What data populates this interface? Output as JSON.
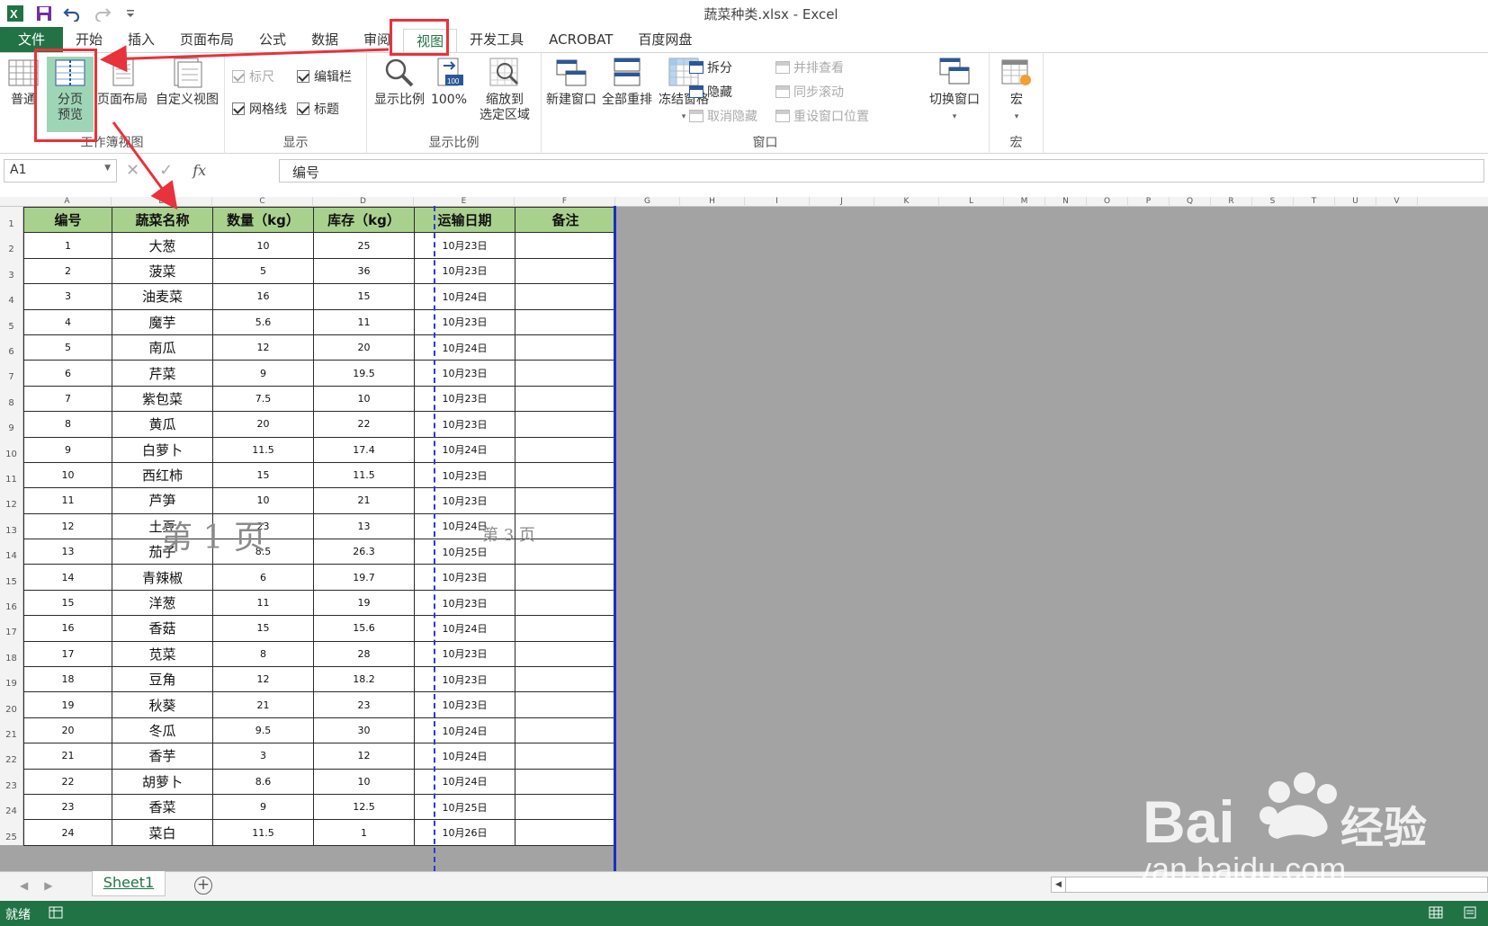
{
  "window": {
    "title": "蔬菜种类.xlsx - Excel"
  },
  "qat": {
    "excel_icon": "excel-logo-icon",
    "save": "save-icon",
    "undo": "undo-icon",
    "redo": "redo-icon",
    "customize": "customize-qat-icon"
  },
  "tabs": [
    "文件",
    "开始",
    "插入",
    "页面布局",
    "公式",
    "数据",
    "审阅",
    "视图",
    "开发工具",
    "ACROBAT",
    "百度网盘"
  ],
  "active_tab": "视图",
  "ribbon": {
    "workbook_views": {
      "label": "工作簿视图",
      "normal": "普通",
      "page_break_1": "分页",
      "page_break_2": "预览",
      "page_layout": "页面布局",
      "custom_views": "自定义视图"
    },
    "show": {
      "label": "显示",
      "ruler": "标尺",
      "formula_bar": "编辑栏",
      "gridlines": "网格线",
      "headings": "标题"
    },
    "zoom": {
      "label": "显示比例",
      "zoom": "显示比例",
      "zoom100": "100%",
      "zoom_sel_1": "缩放到",
      "zoom_sel_2": "选定区域"
    },
    "window": {
      "label": "窗口",
      "new_window": "新建窗口",
      "arrange_all": "全部重排",
      "freeze_panes": "冻结窗格",
      "split": "拆分",
      "hide": "隐藏",
      "unhide": "取消隐藏",
      "side_by_side": "并排查看",
      "sync_scroll": "同步滚动",
      "reset_pos": "重设窗口位置",
      "switch_windows": "切换窗口"
    },
    "macros": {
      "label": "宏",
      "macros": "宏"
    }
  },
  "formula_bar": {
    "name_box": "A1",
    "fx": "fx",
    "content": "编号"
  },
  "columns": [
    "A",
    "B",
    "C",
    "D",
    "E",
    "F",
    "G",
    "H",
    "I",
    "J",
    "K",
    "L",
    "M",
    "N",
    "O",
    "P",
    "Q",
    "R",
    "S",
    "T",
    "U",
    "V"
  ],
  "table": {
    "headers": [
      "编号",
      "蔬菜名称",
      "数量（kg）",
      "库存（kg）",
      "运输日期",
      "备注"
    ],
    "rows": [
      [
        "1",
        "大葱",
        "10",
        "25",
        "10月23日",
        ""
      ],
      [
        "2",
        "菠菜",
        "5",
        "36",
        "10月23日",
        ""
      ],
      [
        "3",
        "油麦菜",
        "16",
        "15",
        "10月24日",
        ""
      ],
      [
        "4",
        "魔芋",
        "5.6",
        "11",
        "10月23日",
        ""
      ],
      [
        "5",
        "南瓜",
        "12",
        "20",
        "10月24日",
        ""
      ],
      [
        "6",
        "芹菜",
        "9",
        "19.5",
        "10月23日",
        ""
      ],
      [
        "7",
        "紫包菜",
        "7.5",
        "10",
        "10月23日",
        ""
      ],
      [
        "8",
        "黄瓜",
        "20",
        "22",
        "10月23日",
        ""
      ],
      [
        "9",
        "白萝卜",
        "11.5",
        "17.4",
        "10月24日",
        ""
      ],
      [
        "10",
        "西红柿",
        "15",
        "11.5",
        "10月23日",
        ""
      ],
      [
        "11",
        "芦笋",
        "10",
        "21",
        "10月23日",
        ""
      ],
      [
        "12",
        "土豆",
        "23",
        "13",
        "10月24日",
        ""
      ],
      [
        "13",
        "茄子",
        "8.5",
        "26.3",
        "10月25日",
        ""
      ],
      [
        "14",
        "青辣椒",
        "6",
        "19.7",
        "10月23日",
        ""
      ],
      [
        "15",
        "洋葱",
        "11",
        "19",
        "10月23日",
        ""
      ],
      [
        "16",
        "香菇",
        "15",
        "15.6",
        "10月24日",
        ""
      ],
      [
        "17",
        "苋菜",
        "8",
        "28",
        "10月23日",
        ""
      ],
      [
        "18",
        "豆角",
        "12",
        "18.2",
        "10月23日",
        ""
      ],
      [
        "19",
        "秋葵",
        "21",
        "23",
        "10月23日",
        ""
      ],
      [
        "20",
        "冬瓜",
        "9.5",
        "30",
        "10月24日",
        ""
      ],
      [
        "21",
        "香芋",
        "3",
        "12",
        "10月24日",
        ""
      ],
      [
        "22",
        "胡萝卜",
        "8.6",
        "10",
        "10月24日",
        ""
      ],
      [
        "23",
        "香菜",
        "9",
        "12.5",
        "10月25日",
        ""
      ],
      [
        "24",
        "菜白",
        "11.5",
        "1",
        "10月26日",
        ""
      ]
    ]
  },
  "page_marks": {
    "page1": "第 1 页",
    "page3": "第 3 页"
  },
  "sheet_tabs": {
    "active": "Sheet1",
    "add": "+"
  },
  "status": {
    "ready": "就绪"
  },
  "watermark": {
    "brand": "Bai",
    "brand_cn": "经验",
    "url": "jingyan.baidu.com"
  },
  "colors": {
    "excel_green": "#217346",
    "header_fill": "#a9d18e",
    "highlight_red": "#e8323c",
    "page_break_blue": "#2b3bd1"
  }
}
